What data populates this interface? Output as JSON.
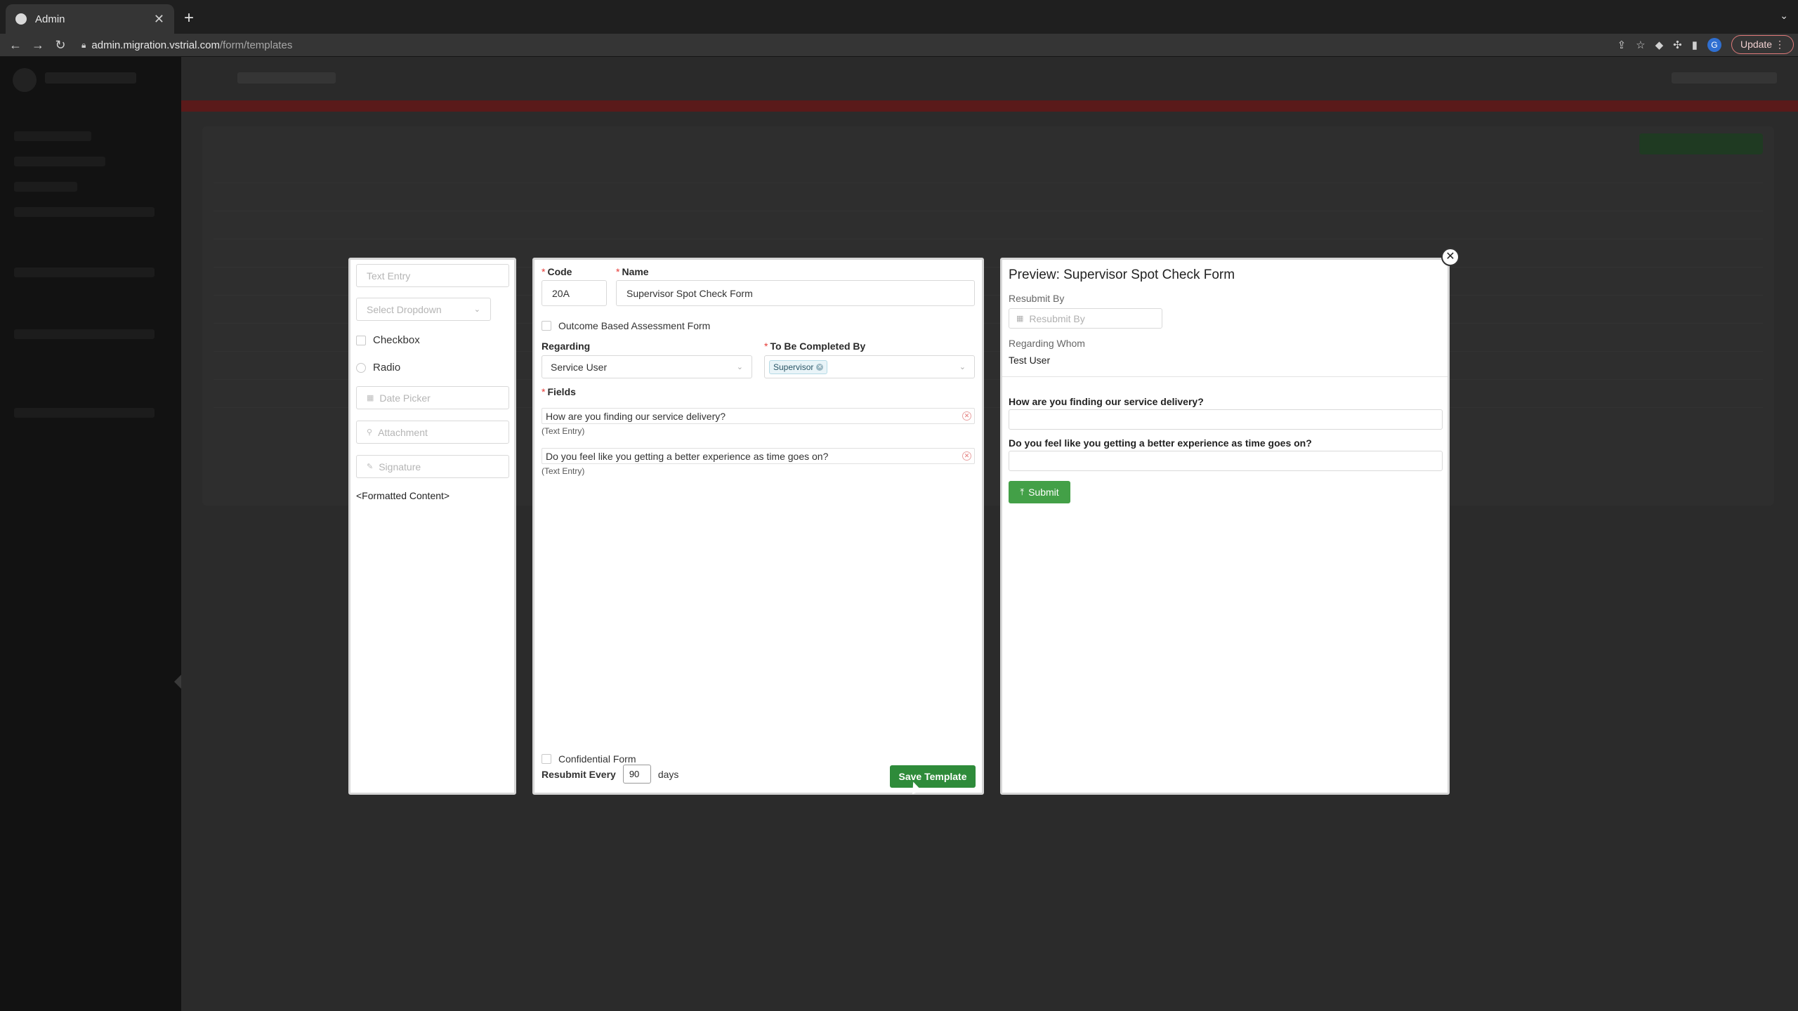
{
  "browser": {
    "tab_title": "Admin",
    "tab_close": "✕",
    "new_tab": "+",
    "tab_menu": "⌄",
    "url_host": "admin.migration.vstrial.com",
    "url_path": "/form/templates",
    "update_label": "Update",
    "profile_initial": "G",
    "icons": [
      "back-icon",
      "forward-icon",
      "reload-icon",
      "lock-icon",
      "share-icon",
      "bookmark-star-icon",
      "extension-icon",
      "puzzle-icon",
      "sidebar-icon",
      "profile-icon",
      "kebab-icon"
    ]
  },
  "palette": {
    "text_entry": "Text Entry",
    "select_dropdown": "Select Dropdown",
    "checkbox": "Checkbox",
    "radio": "Radio",
    "date_picker": "Date Picker",
    "attachment": "Attachment",
    "signature": "Signature",
    "formatted_content": "<Formatted Content>"
  },
  "editor": {
    "code_label": "Code",
    "code_value": "20A",
    "name_label": "Name",
    "name_value": "Supervisor Spot Check Form",
    "outcome_label": "Outcome Based Assessment Form",
    "regarding_label": "Regarding",
    "regarding_value": "Service User",
    "completed_by_label": "To Be Completed By",
    "completed_by_tag": "Supervisor",
    "fields_label": "Fields",
    "fields": [
      {
        "question": "How are you finding our service delivery?",
        "type": "(Text Entry)"
      },
      {
        "question": "Do you feel like you getting a better experience as time goes on?",
        "type": "(Text Entry)"
      }
    ],
    "confidential_label": "Confidential Form",
    "resubmit_label": "Resubmit Every",
    "resubmit_value": "90",
    "resubmit_unit": "days",
    "save_label": "Save Template"
  },
  "preview": {
    "title": "Preview: Supervisor Spot Check Form",
    "resubmit_by_label": "Resubmit By",
    "resubmit_by_placeholder": "Resubmit By",
    "regarding_whom_label": "Regarding Whom",
    "regarding_whom_value": "Test User",
    "questions": [
      "How are you finding our service delivery?",
      "Do you feel like you getting a better experience as time goes on?"
    ],
    "submit_label": "Submit"
  },
  "colors": {
    "save_green": "#2e8b3a",
    "submit_green": "#43a047",
    "required_red": "#e53935",
    "overlay": "#2b2b2b"
  }
}
